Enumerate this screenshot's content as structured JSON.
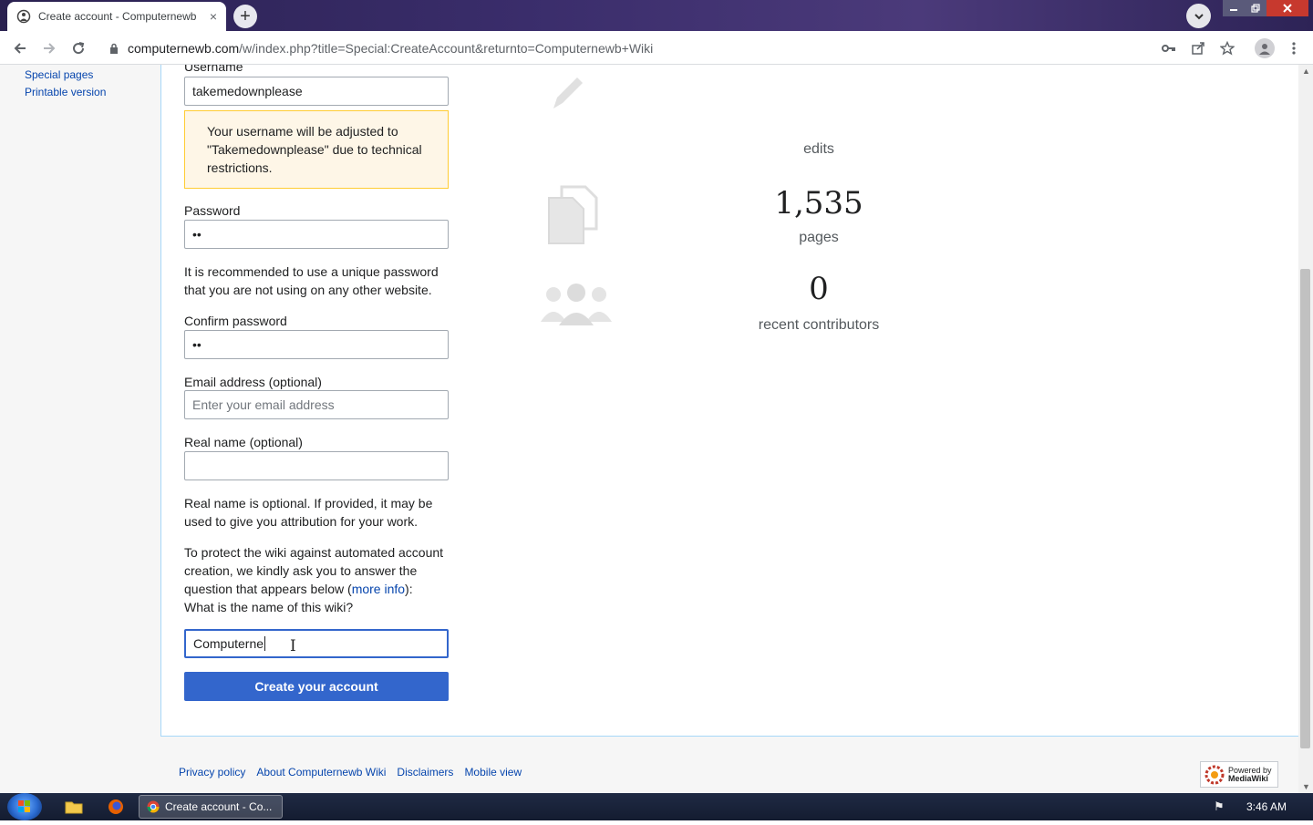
{
  "browser": {
    "tab_title": "Create account - Computernewb",
    "tab_close": "×",
    "new_tab": "+",
    "url_domain": "computernewb.com",
    "url_path": "/w/index.php?title=Special:CreateAccount&returnto=Computernewb+Wiki"
  },
  "sidebar": {
    "items": [
      "Special pages",
      "Printable version"
    ]
  },
  "form": {
    "username_label": "Username",
    "username_value": "takemedownplease",
    "username_notice": "Your username will be adjusted to \"Takemedownplease\" due to technical restrictions.",
    "password_label": "Password",
    "password_value": "••",
    "password_help": "It is recommended to use a unique password that you are not using on any other website.",
    "confirm_label": "Confirm password",
    "confirm_value": "••",
    "email_label": "Email address (optional)",
    "email_placeholder": "Enter your email address",
    "realname_label": "Real name (optional)",
    "realname_value": "",
    "realname_help": "Real name is optional. If provided, it may be used to give you attribution for your work.",
    "captcha_text_1": "To protect the wiki against automated account creation, we kindly ask you to answer the question that appears below (",
    "captcha_link": "more info",
    "captcha_text_2": "):",
    "captcha_question": "What is the name of this wiki?",
    "captcha_value": "Computerne",
    "submit_label": "Create your account"
  },
  "stats": {
    "edits_label": "edits",
    "pages_count": "1,535",
    "pages_label": "pages",
    "contributors_count": "0",
    "contributors_label": "recent contributors"
  },
  "footer": {
    "links": [
      "Privacy policy",
      "About Computernewb Wiki",
      "Disclaimers",
      "Mobile view"
    ],
    "powered_line1": "Powered by",
    "powered_line2": "MediaWiki"
  },
  "taskbar": {
    "task_label": "Create account - Co...",
    "clock": "3:46 AM"
  }
}
